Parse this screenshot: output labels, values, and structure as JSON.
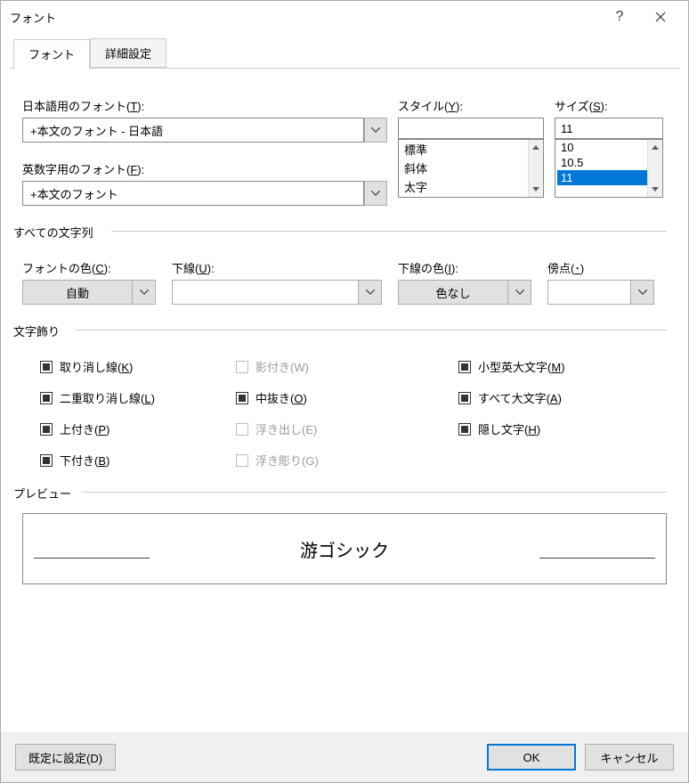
{
  "window": {
    "title": "フォント"
  },
  "tabs": {
    "font": "フォント",
    "advanced": "詳細設定"
  },
  "labels": {
    "jp_font_a": "日本語用のフォント(",
    "jp_font_u": "T",
    "jp_font_b": "):",
    "en_font_a": "英数字用のフォント(",
    "en_font_u": "F",
    "en_font_b": "):",
    "style_a": "スタイル(",
    "style_u": "Y",
    "style_b": "):",
    "size_a": "サイズ(",
    "size_u": "S",
    "size_b": "):"
  },
  "values": {
    "jp_font": "+本文のフォント - 日本語",
    "en_font": "+本文のフォント",
    "size_input": "11"
  },
  "style_list": [
    "標準",
    "斜体",
    "太字"
  ],
  "size_list": [
    "10",
    "10.5",
    "11"
  ],
  "group_all_text": "すべての文字列",
  "all_text": {
    "color_a": "フォントの色(",
    "color_u": "C",
    "color_b": "):",
    "color_val": "自動",
    "underline_a": "下線(",
    "underline_u": "U",
    "underline_b": "):",
    "underline_val": "",
    "ucolor_a": "下線の色(",
    "ucolor_u": "I",
    "ucolor_b": "):",
    "ucolor_val": "色なし",
    "emph_a": "傍点(",
    "emph_u": "･",
    "emph_b": ")",
    "emph_val": ""
  },
  "group_effects": "文字飾り",
  "effects": {
    "strike_a": "取り消し線(",
    "strike_u": "K",
    "strike_b": ")",
    "dstrike_a": "二重取り消し線(",
    "dstrike_u": "L",
    "dstrike_b": ")",
    "super_a": "上付き(",
    "super_u": "P",
    "super_b": ")",
    "sub_a": "下付き(",
    "sub_u": "B",
    "sub_b": ")",
    "shadow_a": "影付き(",
    "shadow_u": "W",
    "shadow_b": ")",
    "outline_a": "中抜き(",
    "outline_u": "O",
    "outline_b": ")",
    "emboss_a": "浮き出し(",
    "emboss_u": "E",
    "emboss_b": ")",
    "engrave_a": "浮き彫り(",
    "engrave_u": "G",
    "engrave_b": ")",
    "smallcaps_a": "小型英大文字(",
    "smallcaps_u": "M",
    "smallcaps_b": ")",
    "allcaps_a": "すべて大文字(",
    "allcaps_u": "A",
    "allcaps_b": ")",
    "hidden_a": "隠し文字(",
    "hidden_u": "H",
    "hidden_b": ")"
  },
  "group_preview": "プレビュー",
  "preview_text": "游ゴシック",
  "footer": {
    "set_default": "既定に設定(D)",
    "ok": "OK",
    "cancel": "キャンセル"
  }
}
